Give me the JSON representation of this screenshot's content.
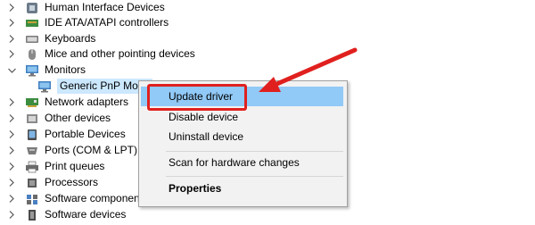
{
  "tree": {
    "items": [
      {
        "label": "Human Interface Devices",
        "icon": "hid-icon",
        "expanded": false
      },
      {
        "label": "IDE ATA/ATAPI controllers",
        "icon": "ide-controller-icon",
        "expanded": false
      },
      {
        "label": "Keyboards",
        "icon": "keyboard-icon",
        "expanded": false
      },
      {
        "label": "Mice and other pointing devices",
        "icon": "mouse-icon",
        "expanded": false
      },
      {
        "label": "Monitors",
        "icon": "monitor-icon",
        "expanded": true
      },
      {
        "label": "Generic PnP Monit",
        "icon": "monitor-icon",
        "child": true
      },
      {
        "label": "Network adapters",
        "icon": "network-adapter-icon",
        "expanded": false
      },
      {
        "label": "Other devices",
        "icon": "other-devices-icon",
        "expanded": false
      },
      {
        "label": "Portable Devices",
        "icon": "portable-device-icon",
        "expanded": false
      },
      {
        "label": "Ports (COM & LPT)",
        "icon": "port-icon",
        "expanded": false
      },
      {
        "label": "Print queues",
        "icon": "printer-icon",
        "expanded": false
      },
      {
        "label": "Processors",
        "icon": "processor-icon",
        "expanded": false
      },
      {
        "label": "Software components",
        "icon": "software-component-icon",
        "expanded": false
      },
      {
        "label": "Software devices",
        "icon": "software-device-icon",
        "expanded": false
      }
    ]
  },
  "context_menu": {
    "update_driver": "Update driver",
    "disable_device": "Disable device",
    "uninstall_device": "Uninstall device",
    "scan_hardware": "Scan for hardware changes",
    "properties": "Properties"
  },
  "colors": {
    "highlight": "#91c9f7",
    "annotation_red": "#e0201e",
    "selection": "#cce8ff"
  }
}
